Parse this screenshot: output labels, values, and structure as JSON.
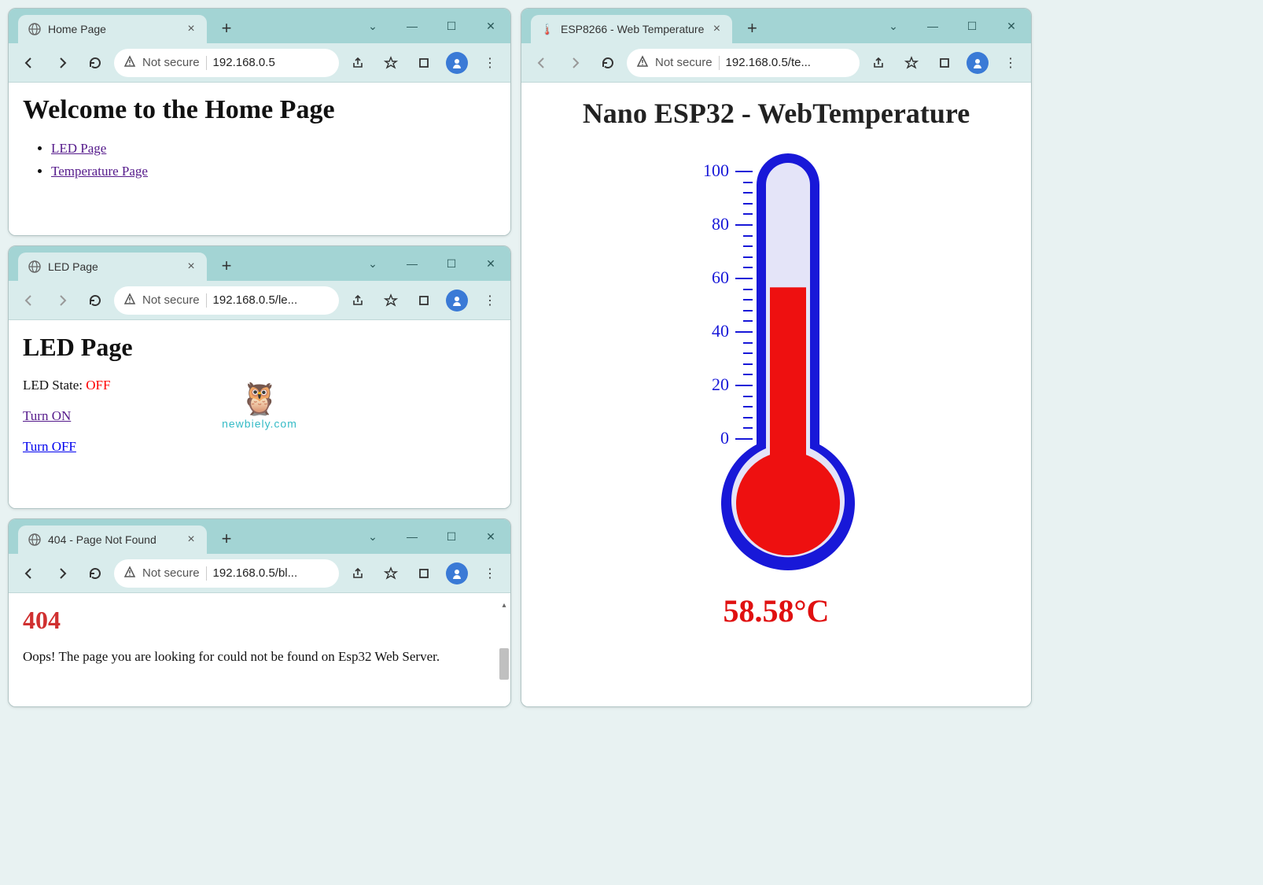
{
  "windows": {
    "home": {
      "tab_title": "Home Page",
      "secure_label": "Not secure",
      "url": "192.168.0.5",
      "heading": "Welcome to the Home Page",
      "links": [
        "LED Page",
        "Temperature Page"
      ]
    },
    "led": {
      "tab_title": "LED Page",
      "secure_label": "Not secure",
      "url": "192.168.0.5/le...",
      "heading": "LED Page",
      "state_label": "LED State: ",
      "state_value": "OFF",
      "link_on": "Turn ON",
      "link_off": "Turn OFF"
    },
    "notfound": {
      "tab_title": "404 - Page Not Found",
      "secure_label": "Not secure",
      "url": "192.168.0.5/bl...",
      "code": "404",
      "msg": "Oops! The page you are looking for could not be found on Esp32 Web Server."
    },
    "temp": {
      "tab_title": "ESP8266 - Web Temperature",
      "secure_label": "Not secure",
      "url": "192.168.0.5/te...",
      "heading": "Nano ESP32 - WebTemperature",
      "value_display": "58.58°C",
      "value": 58.58,
      "scale_min": 0,
      "scale_max": 100,
      "tick_labels": [
        "100",
        "80",
        "60",
        "40",
        "20",
        "0"
      ]
    }
  },
  "watermark": "newbiely.com",
  "colors": {
    "thermo_blue": "#1818d8",
    "thermo_red": "#ee1010",
    "link_visited": "#551a8b",
    "link_blue": "#0000ee"
  }
}
